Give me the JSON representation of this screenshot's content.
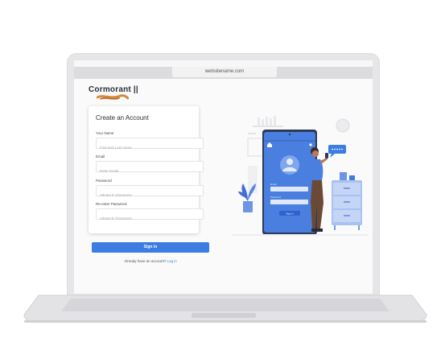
{
  "browser": {
    "url": "websitename.com"
  },
  "brand": {
    "name": "Cormorant ||"
  },
  "form": {
    "title": "Create an Account",
    "fields": [
      {
        "label": "Your Name",
        "placeholder": "First and Last name"
      },
      {
        "label": "Email",
        "placeholder": "Enter Email"
      },
      {
        "label": "Password",
        "placeholder": "Atleast 8 characters"
      },
      {
        "label": "Re-enter Password",
        "placeholder": "Atleast 8 characters"
      }
    ],
    "submit_label": "Sign in",
    "already_text": "Already have an account?",
    "login_link": "Log in"
  },
  "illustration": {
    "phone_email_label": "Email",
    "phone_password_label": "Password",
    "phone_signin_label": "Sign In",
    "colors": {
      "accent": "#3d7de3",
      "phone": "#4a7fe0",
      "furniture": "#a9c2f2"
    }
  },
  "colors": {
    "accent": "#3d7de3",
    "lid": "#e6e6e8"
  }
}
